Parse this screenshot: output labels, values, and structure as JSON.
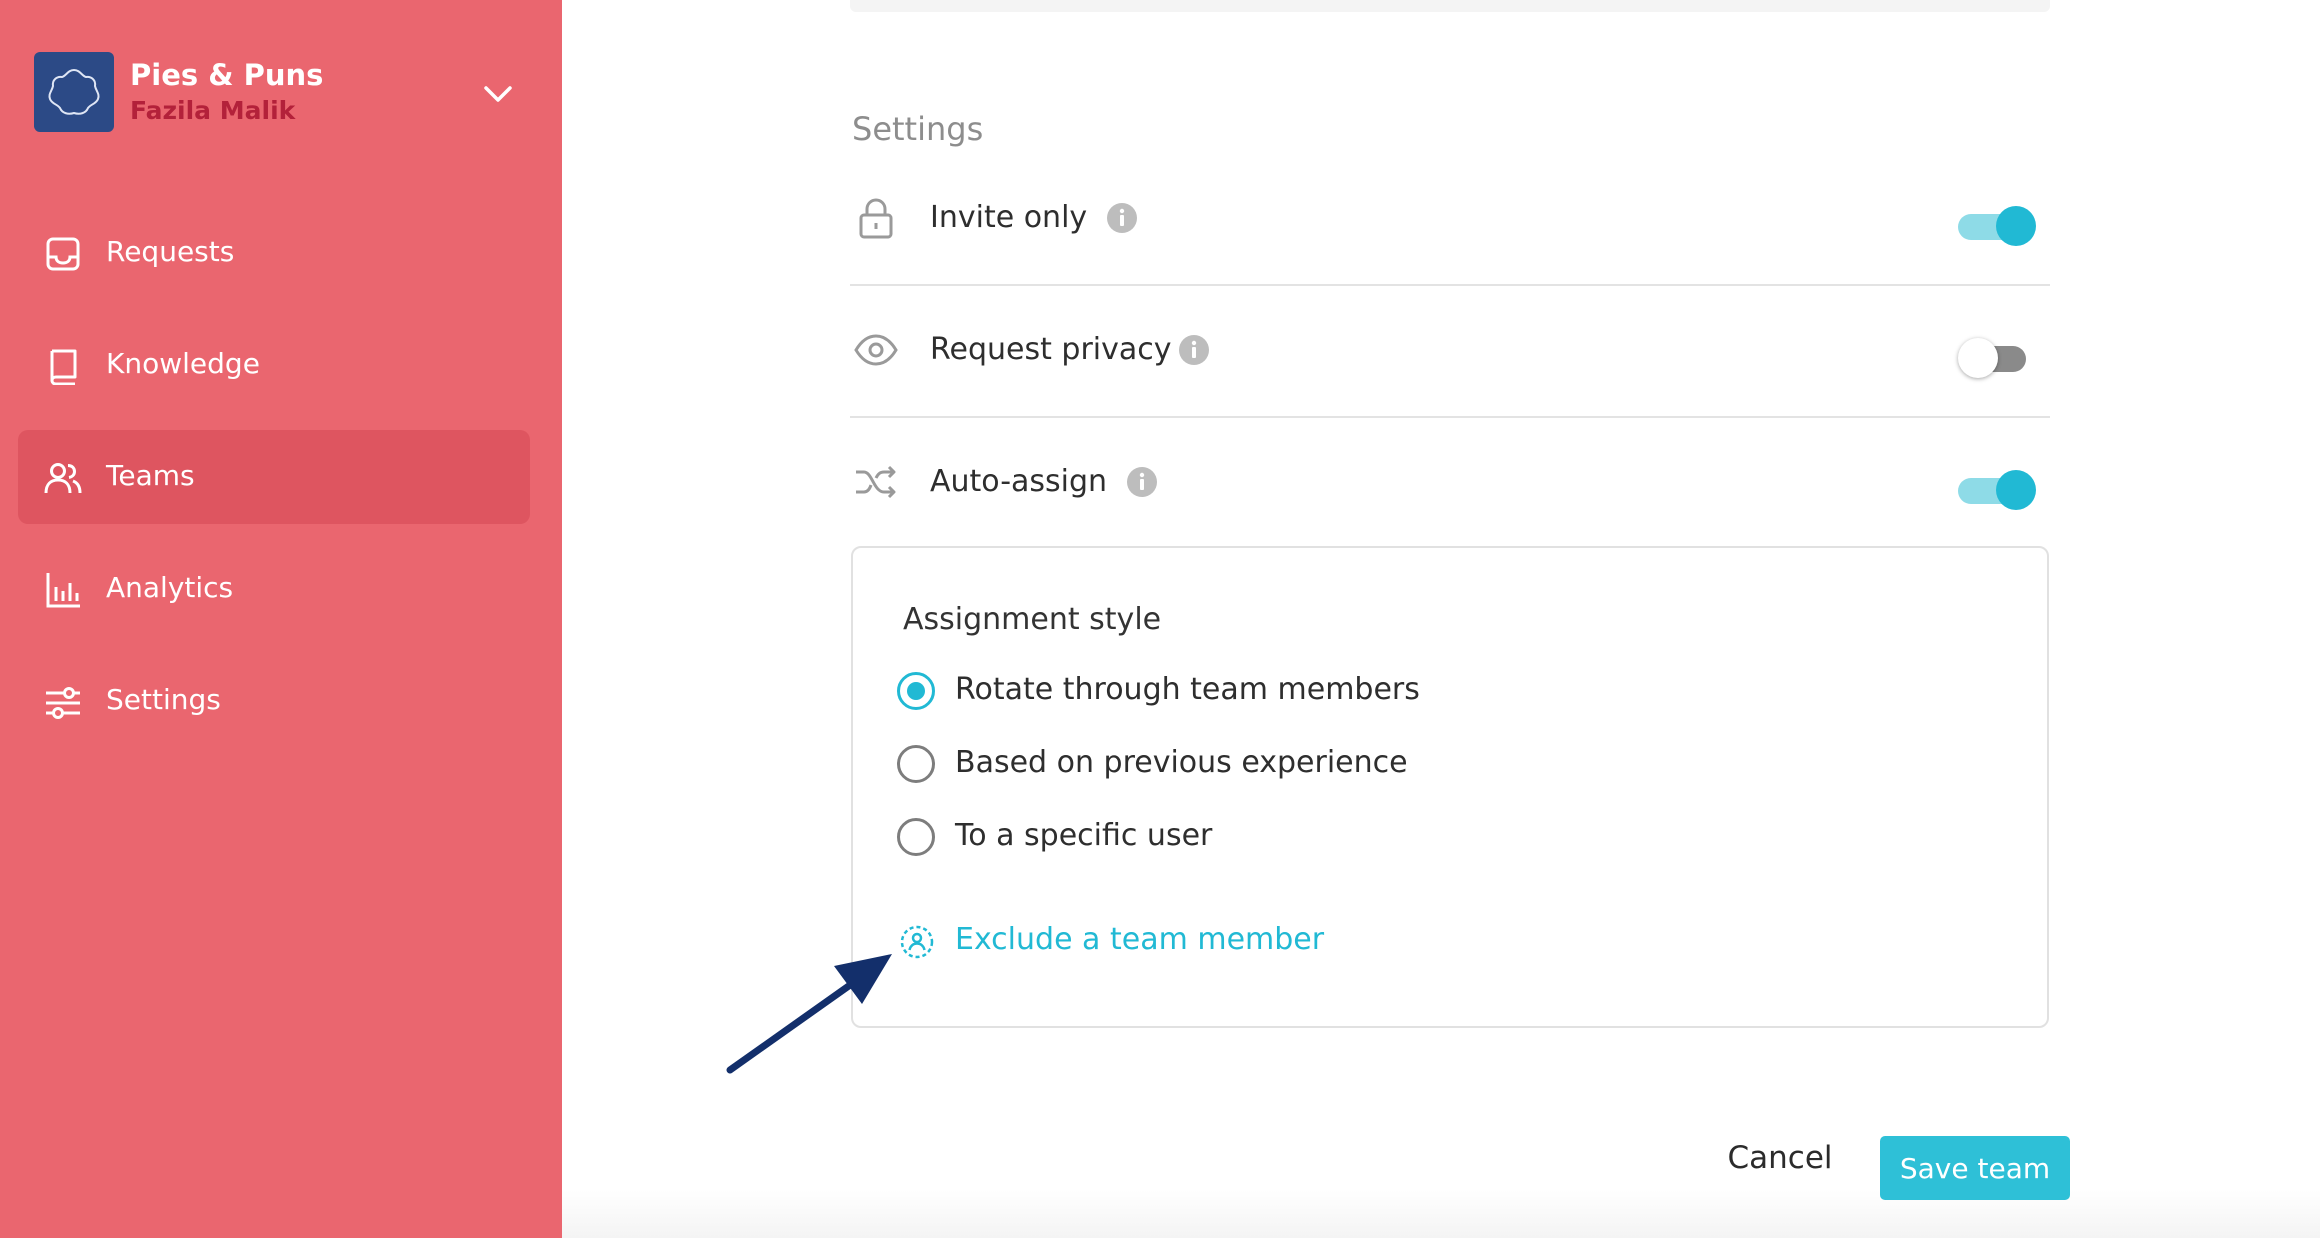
{
  "workspace": {
    "name": "Pies & Puns",
    "user": "Fazila Malik"
  },
  "nav": {
    "items": [
      {
        "label": "Requests",
        "icon": "inbox-icon"
      },
      {
        "label": "Knowledge",
        "icon": "book-icon"
      },
      {
        "label": "Teams",
        "icon": "people-icon",
        "active": true
      },
      {
        "label": "Analytics",
        "icon": "bar-chart-icon"
      },
      {
        "label": "Settings",
        "icon": "sliders-icon"
      }
    ]
  },
  "settings": {
    "title": "Settings",
    "rows": [
      {
        "label": "Invite only",
        "icon": "lock-icon",
        "enabled": true
      },
      {
        "label": "Request privacy",
        "icon": "eye-icon",
        "enabled": false
      },
      {
        "label": "Auto-assign",
        "icon": "shuffle-icon",
        "enabled": true
      }
    ]
  },
  "assignment": {
    "title": "Assignment style",
    "options": [
      {
        "label": "Rotate through team members",
        "selected": true
      },
      {
        "label": "Based on previous experience",
        "selected": false
      },
      {
        "label": "To a specific user",
        "selected": false
      }
    ],
    "exclude_label": "Exclude a team member"
  },
  "actions": {
    "cancel_label": "Cancel",
    "save_label": "Save team"
  },
  "colors": {
    "sidebar": "#ea666f",
    "accent": "#21b9d4",
    "workspace_logo": "#2c4a86",
    "arrow": "#132f6b"
  }
}
